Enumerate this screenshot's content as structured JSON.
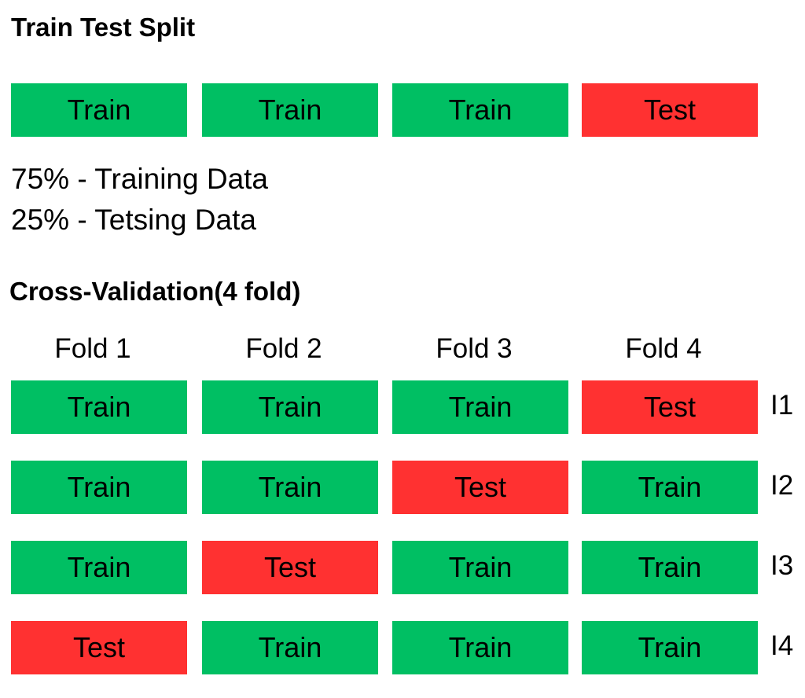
{
  "colors": {
    "train": "#00bf63",
    "test": "#ff3131"
  },
  "split": {
    "title": "Train Test Split",
    "blocks": [
      "Train",
      "Train",
      "Train",
      "Test"
    ],
    "lines": [
      "75% - Training Data",
      "25% - Tetsing Data"
    ]
  },
  "cv": {
    "title": "Cross-Validation(4 fold)",
    "folds": [
      "Fold 1",
      "Fold 2",
      "Fold 3",
      "Fold 4"
    ],
    "rows": [
      {
        "label": "I1",
        "blocks": [
          "Train",
          "Train",
          "Train",
          "Test"
        ]
      },
      {
        "label": "I2",
        "blocks": [
          "Train",
          "Train",
          "Test",
          "Train"
        ]
      },
      {
        "label": "I3",
        "blocks": [
          "Train",
          "Test",
          "Train",
          "Train"
        ]
      },
      {
        "label": "I4",
        "blocks": [
          "Test",
          "Train",
          "Train",
          "Train"
        ]
      }
    ]
  }
}
